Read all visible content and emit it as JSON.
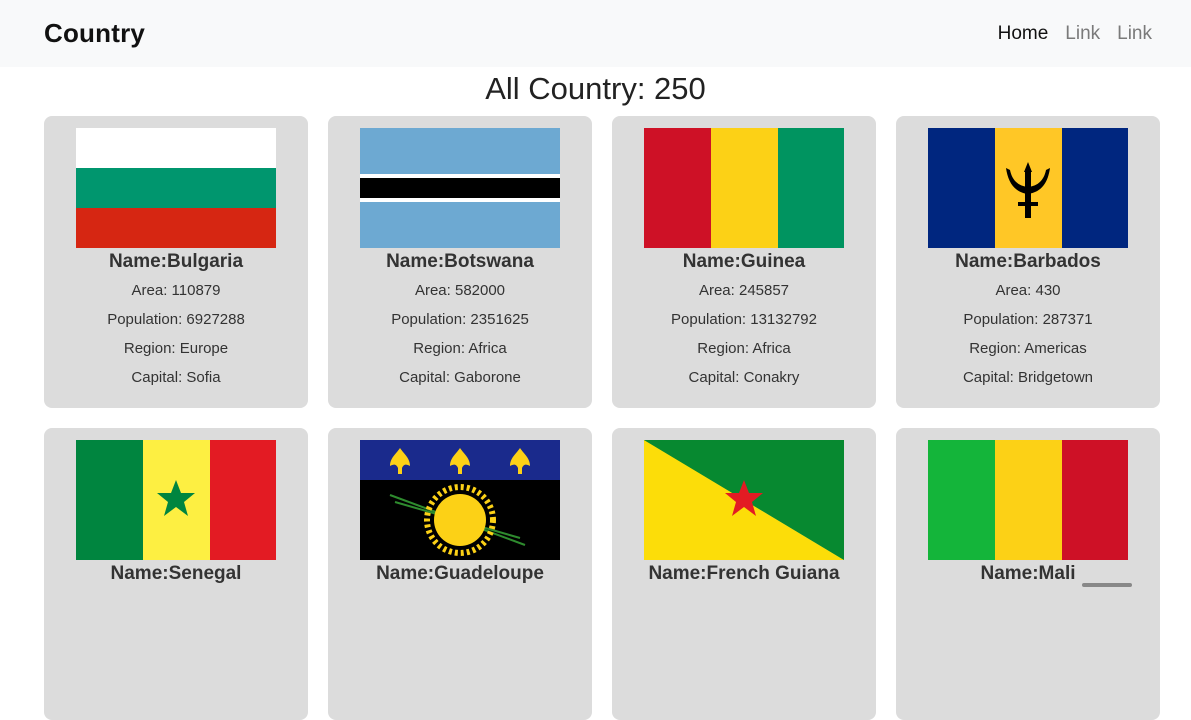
{
  "navbar": {
    "brand": "Country",
    "links": [
      "Home",
      "Link",
      "Link"
    ]
  },
  "heading": "All Country: 250",
  "countries": [
    {
      "name": "Name:Bulgaria",
      "area": "Area: 110879",
      "population": "Population: 6927288",
      "region": "Region: Europe",
      "capital": "Capital: Sofia",
      "flag": "bulgaria-flag"
    },
    {
      "name": "Name:Botswana",
      "area": "Area: 582000",
      "population": "Population: 2351625",
      "region": "Region: Africa",
      "capital": "Capital: Gaborone",
      "flag": "botswana-flag"
    },
    {
      "name": "Name:Guinea",
      "area": "Area: 245857",
      "population": "Population: 13132792",
      "region": "Region: Africa",
      "capital": "Capital: Conakry",
      "flag": "guinea-flag"
    },
    {
      "name": "Name:Barbados",
      "area": "Area: 430",
      "population": "Population: 287371",
      "region": "Region: Americas",
      "capital": "Capital: Bridgetown",
      "flag": "barbados-flag"
    },
    {
      "name": "Name:Senegal",
      "flag": "senegal-flag"
    },
    {
      "name": "Name:Guadeloupe",
      "flag": "guadeloupe-flag"
    },
    {
      "name": "Name:French Guiana",
      "flag": "french-guiana-flag"
    },
    {
      "name": "Name:Mali",
      "flag": "mali-flag"
    }
  ],
  "colors": {
    "navbar_bg": "#f8f9fa",
    "card_bg": "#dcdcdc"
  }
}
